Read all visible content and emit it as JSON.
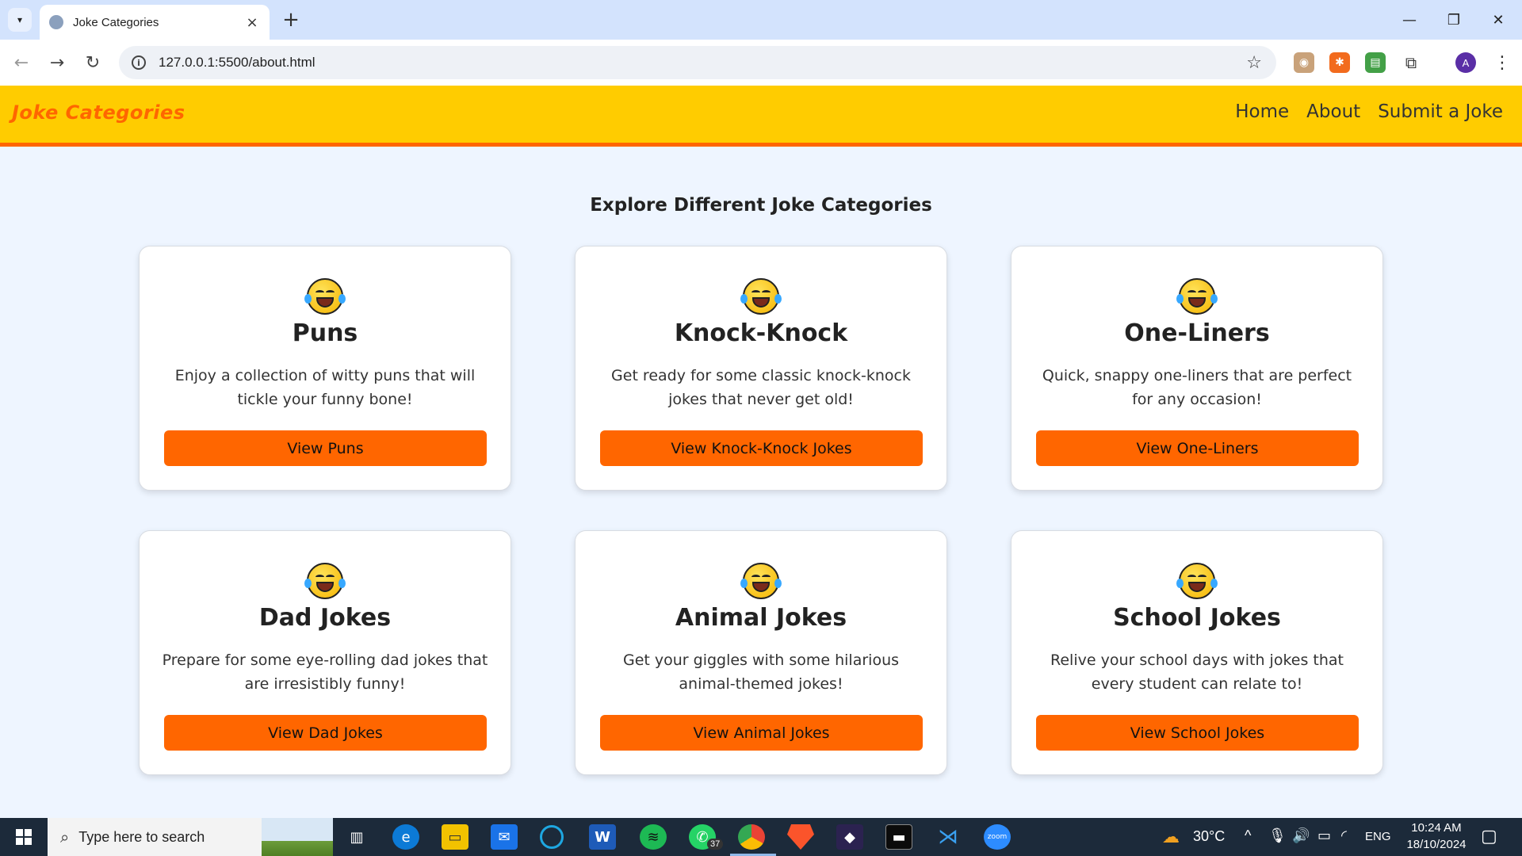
{
  "browser": {
    "tab_title": "Joke Categories",
    "url": "127.0.0.1:5500/about.html",
    "profile_initial": "A"
  },
  "site": {
    "logo": "Joke Categories",
    "nav": [
      "Home",
      "About",
      "Submit a Joke"
    ],
    "section_title": "Explore Different Joke Categories",
    "cards": [
      {
        "title": "Puns",
        "desc": "Enjoy a collection of witty puns that will tickle your funny bone!",
        "button": "View Puns"
      },
      {
        "title": "Knock-Knock",
        "desc": "Get ready for some classic knock-knock jokes that never get old!",
        "button": "View Knock-Knock Jokes"
      },
      {
        "title": "One-Liners",
        "desc": "Quick, snappy one-liners that are perfect for any occasion!",
        "button": "View One-Liners"
      },
      {
        "title": "Dad Jokes",
        "desc": "Prepare for some eye-rolling dad jokes that are irresistibly funny!",
        "button": "View Dad Jokes"
      },
      {
        "title": "Animal Jokes",
        "desc": "Get your giggles with some hilarious animal-themed jokes!",
        "button": "View Animal Jokes"
      },
      {
        "title": "School Jokes",
        "desc": "Relive your school days with jokes that every student can relate to!",
        "button": "View School Jokes"
      }
    ]
  },
  "taskbar": {
    "search_placeholder": "Type here to search",
    "whatsapp_badge": "37",
    "weather": "30°C",
    "language": "ENG",
    "time": "10:24 AM",
    "date": "18/10/2024"
  },
  "colors": {
    "header_bg": "#ffcc00",
    "accent": "#ff6600",
    "page_bg": "#eef5ff"
  }
}
